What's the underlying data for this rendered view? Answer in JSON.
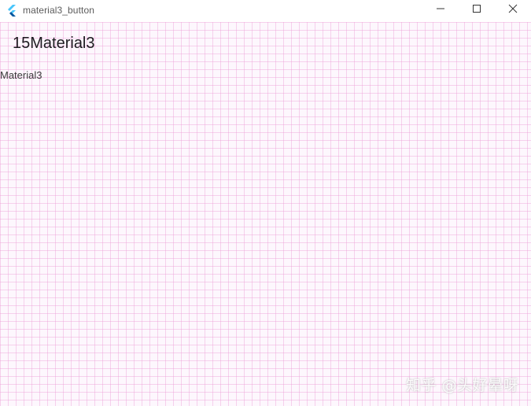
{
  "window": {
    "title": "material3_button",
    "icon": "flutter-icon",
    "controls": {
      "minimize": "minimize-icon",
      "maximize": "maximize-icon",
      "close": "close-icon"
    }
  },
  "content": {
    "heading": "15Material3",
    "label": "Material3",
    "background_color": "#fdf7fd",
    "grid_color": "#eca0d6"
  },
  "watermark": {
    "text": "知乎 @头好晕呀"
  }
}
